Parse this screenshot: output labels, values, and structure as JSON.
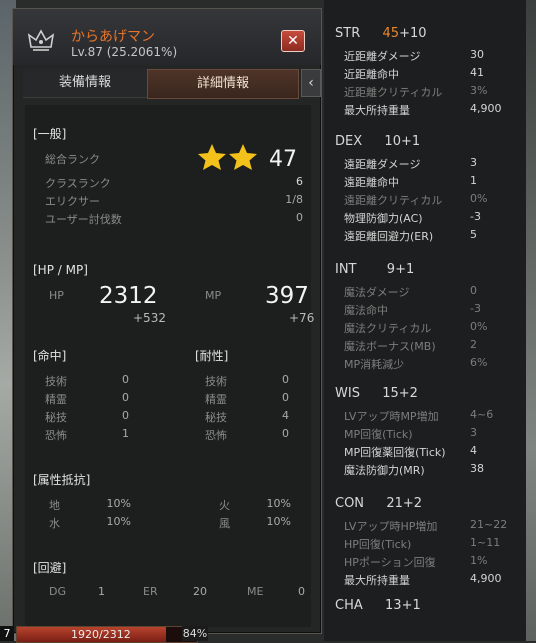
{
  "character": {
    "name": "からあげマン",
    "level_text": "Lv.87 (25.2061%)"
  },
  "tabs": [
    {
      "label": "装備情報",
      "active": false
    },
    {
      "label": "詳細情報",
      "active": true
    }
  ],
  "tab_arrow": "‹",
  "close_glyph": "✕",
  "general": {
    "title": "[一般]",
    "overall_rank_label": "総合ランク",
    "overall_rank_stars": 2,
    "overall_rank_value": "47",
    "class_rank_label": "クラスランク",
    "class_rank_value": "6",
    "elixir_label": "エリクサー",
    "elixir_value": "1/8",
    "user_kills_label": "ユーザー討伐数",
    "user_kills_value": "0"
  },
  "hpmp": {
    "title": "[HP / MP]",
    "hp_label": "HP",
    "hp_value": "2312",
    "hp_bonus": "+532",
    "mp_label": "MP",
    "mp_value": "397",
    "mp_bonus": "+76"
  },
  "hit": {
    "title": "[命中]",
    "rows": [
      {
        "label": "技術",
        "value": "0"
      },
      {
        "label": "精霊",
        "value": "0"
      },
      {
        "label": "秘技",
        "value": "0"
      },
      {
        "label": "恐怖",
        "value": "1"
      }
    ]
  },
  "resist": {
    "title": "[耐性]",
    "rows": [
      {
        "label": "技術",
        "value": "0"
      },
      {
        "label": "精霊",
        "value": "0"
      },
      {
        "label": "秘技",
        "value": "4"
      },
      {
        "label": "恐怖",
        "value": "0"
      }
    ]
  },
  "element": {
    "title": "[属性抵抗]",
    "rows": [
      {
        "label": "地",
        "value": "10%"
      },
      {
        "label": "火",
        "value": "10%"
      },
      {
        "label": "水",
        "value": "10%"
      },
      {
        "label": "風",
        "value": "10%"
      }
    ]
  },
  "evasion": {
    "title": "[回避]",
    "dg_label": "DG",
    "dg_value": "1",
    "er_label": "ER",
    "er_value": "20",
    "me_label": "ME",
    "me_value": "0"
  },
  "hpbar": {
    "text": "1920/2312",
    "percent_text": "84%",
    "fill_fraction": 0.83,
    "level_digit": "7"
  },
  "stats": {
    "str": {
      "name": "STR",
      "base": "45",
      "bonus": "+10",
      "rows": [
        {
          "label": "近距離ダメージ",
          "value": "30",
          "active": true
        },
        {
          "label": "近距離命中",
          "value": "41",
          "active": true
        },
        {
          "label": "近距離クリティカル",
          "value": "3%",
          "active": false
        },
        {
          "label": "最大所持重量",
          "value": "4,900",
          "active": true
        }
      ]
    },
    "dex": {
      "name": "DEX",
      "base": "10",
      "bonus": "+1",
      "rows": [
        {
          "label": "遠距離ダメージ",
          "value": "3",
          "active": true
        },
        {
          "label": "遠距離命中",
          "value": "1",
          "active": true
        },
        {
          "label": "遠距離クリティカル",
          "value": "0%",
          "active": false
        },
        {
          "label": "物理防御力(AC)",
          "value": "-3",
          "active": true
        },
        {
          "label": "遠距離回避力(ER)",
          "value": "5",
          "active": true
        }
      ]
    },
    "int": {
      "name": "INT",
      "base": "9",
      "bonus": "+1",
      "rows": [
        {
          "label": "魔法ダメージ",
          "value": "0",
          "active": false
        },
        {
          "label": "魔法命中",
          "value": "-3",
          "active": false
        },
        {
          "label": "魔法クリティカル",
          "value": "0%",
          "active": false
        },
        {
          "label": "魔法ボーナス(MB)",
          "value": "2",
          "active": false
        },
        {
          "label": "MP消耗減少",
          "value": "6%",
          "active": false
        }
      ]
    },
    "wis": {
      "name": "WIS",
      "base": "15",
      "bonus": "+2",
      "rows": [
        {
          "label": "LVアップ時MP増加",
          "value": "4~6",
          "active": false
        },
        {
          "label": "MP回復(Tick)",
          "value": "3",
          "active": false
        },
        {
          "label": "MP回復薬回復(Tick)",
          "value": "4",
          "active": true
        },
        {
          "label": "魔法防御力(MR)",
          "value": "38",
          "active": true
        }
      ]
    },
    "con": {
      "name": "CON",
      "base": "21",
      "bonus": "+2",
      "rows": [
        {
          "label": "LVアップ時HP増加",
          "value": "21~22",
          "active": false
        },
        {
          "label": "HP回復(Tick)",
          "value": "1~11",
          "active": false
        },
        {
          "label": "HPポーション回復",
          "value": "1%",
          "active": false
        },
        {
          "label": "最大所持重量",
          "value": "4,900",
          "active": true
        }
      ]
    },
    "cha": {
      "name": "CHA",
      "base": "13",
      "bonus": "+1"
    }
  },
  "colors": {
    "accent_orange": "#e6742a",
    "star_gold": "#f2c21a",
    "close_red": "#c64c3c"
  }
}
